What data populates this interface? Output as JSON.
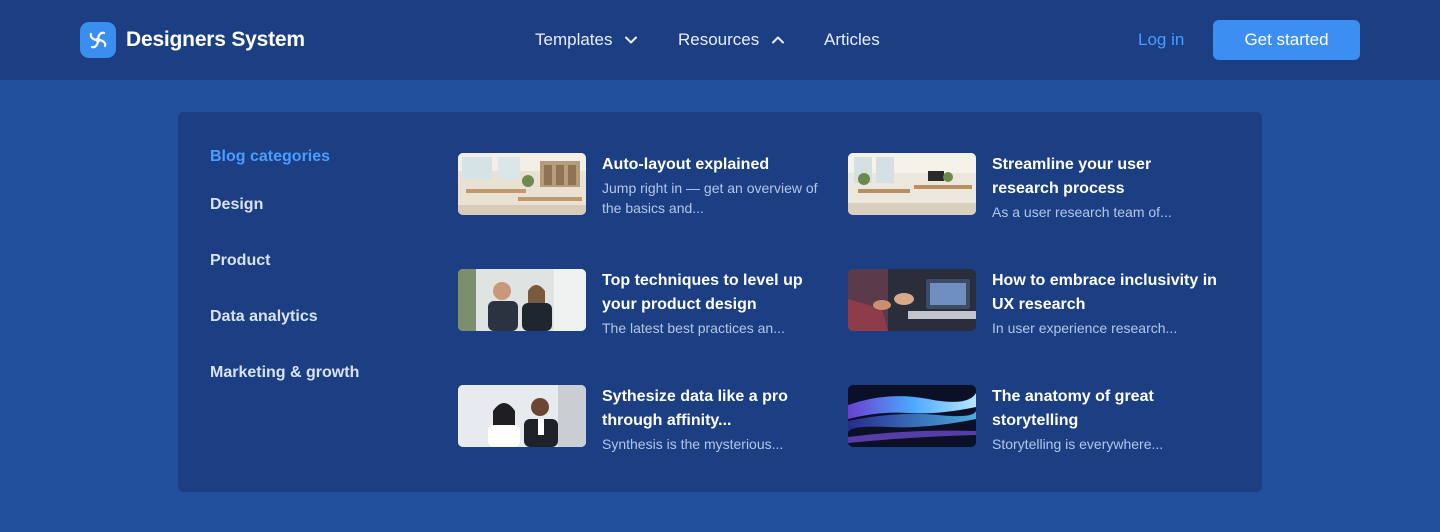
{
  "brand": {
    "name": "Designers System",
    "logo_icon": "flower-swirl-icon",
    "logo_color": "#3a8ef0"
  },
  "nav": {
    "templates": {
      "label": "Templates",
      "icon": "chevron-down-icon"
    },
    "resources": {
      "label": "Resources",
      "icon": "chevron-up-icon"
    },
    "articles": {
      "label": "Articles"
    }
  },
  "actions": {
    "login": "Log in",
    "get_started": "Get started"
  },
  "menu": {
    "categories_title": "Blog categories",
    "categories": [
      "Design",
      "Product",
      "Data analytics",
      "Marketing & growth"
    ],
    "articles": [
      {
        "title": "Auto-layout explained",
        "desc": "Jump right in — get an overview of the basics and..."
      },
      {
        "title": "Streamline your user research process",
        "desc": "As a user research team of..."
      },
      {
        "title": "Top techniques to level up your product design",
        "desc": "The latest best practices an..."
      },
      {
        "title": "How to embrace inclusivity in UX research",
        "desc": "In user experience research..."
      },
      {
        "title": "Sythesize data like a pro through affinity...",
        "desc": "Synthesis is the mysterious..."
      },
      {
        "title": "The anatomy of great storytelling",
        "desc": "Storytelling is everywhere..."
      }
    ]
  },
  "colors": {
    "page_bg": "#23509c",
    "nav_bg": "#1b3f82",
    "panel_bg": "#1b3f82",
    "accent": "#4a9cff",
    "button": "#3d8ef2"
  }
}
